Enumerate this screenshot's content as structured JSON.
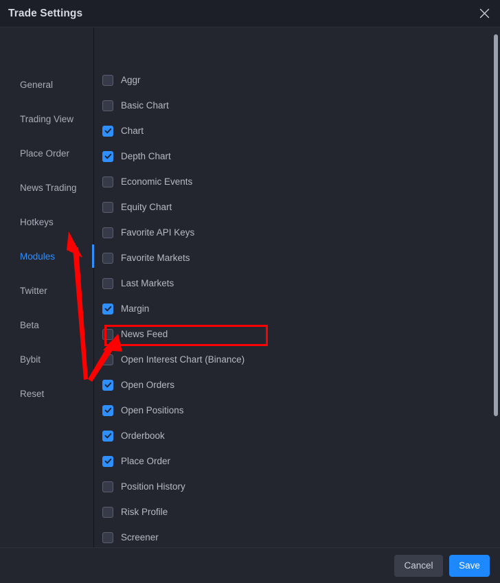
{
  "window": {
    "title": "Trade Settings",
    "close_icon": "close-icon"
  },
  "sidebar": {
    "items": [
      {
        "label": "General",
        "active": false
      },
      {
        "label": "Trading View",
        "active": false
      },
      {
        "label": "Place Order",
        "active": false
      },
      {
        "label": "News Trading",
        "active": false
      },
      {
        "label": "Hotkeys",
        "active": false
      },
      {
        "label": "Modules",
        "active": true
      },
      {
        "label": "Twitter",
        "active": false
      },
      {
        "label": "Beta",
        "active": false
      },
      {
        "label": "Bybit",
        "active": false
      },
      {
        "label": "Reset",
        "active": false
      }
    ]
  },
  "modules": {
    "options": [
      {
        "label": "Aggr",
        "checked": false
      },
      {
        "label": "Basic Chart",
        "checked": false
      },
      {
        "label": "Chart",
        "checked": true
      },
      {
        "label": "Depth Chart",
        "checked": true
      },
      {
        "label": "Economic Events",
        "checked": false
      },
      {
        "label": "Equity Chart",
        "checked": false
      },
      {
        "label": "Favorite API Keys",
        "checked": false
      },
      {
        "label": "Favorite Markets",
        "checked": false
      },
      {
        "label": "Last Markets",
        "checked": false
      },
      {
        "label": "Margin",
        "checked": true
      },
      {
        "label": "News Feed",
        "checked": false
      },
      {
        "label": "Open Interest Chart (Binance)",
        "checked": false
      },
      {
        "label": "Open Orders",
        "checked": true
      },
      {
        "label": "Open Positions",
        "checked": true
      },
      {
        "label": "Orderbook",
        "checked": true
      },
      {
        "label": "Place Order",
        "checked": true
      },
      {
        "label": "Position History",
        "checked": false
      },
      {
        "label": "Risk Profile",
        "checked": false
      },
      {
        "label": "Screener",
        "checked": false
      }
    ]
  },
  "footer": {
    "cancel_label": "Cancel",
    "save_label": "Save"
  },
  "colors": {
    "accent": "#2F8FFF",
    "save_button": "#1E88FF",
    "annotation": "#FF0000",
    "dialog_background": "#23262F",
    "header_background": "#1C1F28"
  },
  "annotation": {
    "highlighted_option": "Open Interest Chart (Binance)",
    "pointer_targets": [
      "Modules",
      "Open Interest Chart (Binance)"
    ]
  }
}
